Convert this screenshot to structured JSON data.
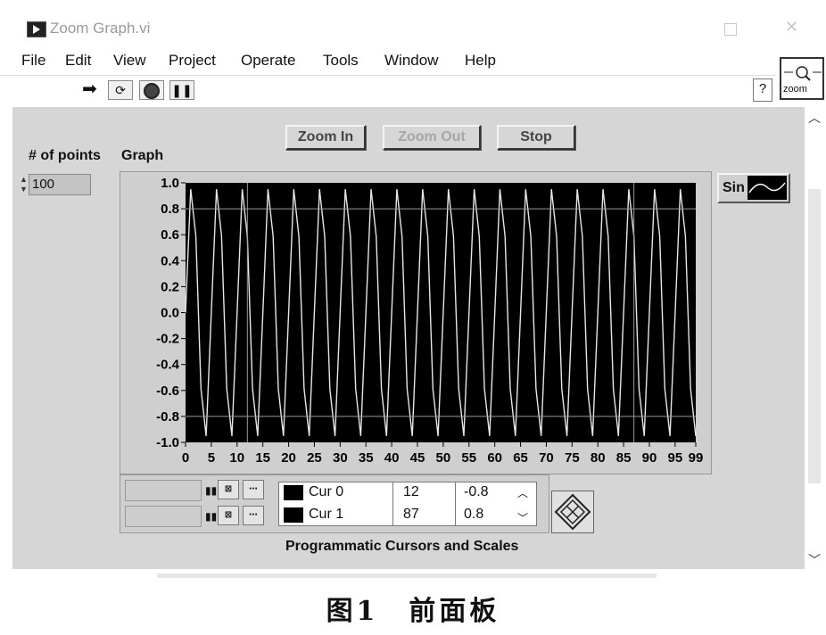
{
  "window": {
    "title": "Zoom Graph.vi"
  },
  "menu": [
    "File",
    "Edit",
    "View",
    "Project",
    "Operate",
    "Tools",
    "Window",
    "Help"
  ],
  "toolbar": {
    "help_glyph": "?",
    "vi_icon_label": "zoom"
  },
  "buttons": {
    "zoom_in": "Zoom In",
    "zoom_out": "Zoom Out",
    "stop": "Stop",
    "zoom_out_disabled": true
  },
  "points": {
    "label": "# of points",
    "value": "100"
  },
  "graph": {
    "label": "Graph",
    "legend_name": "Sin",
    "cursor_lines": {
      "cur0": [
        12,
        -0.8
      ],
      "cur1": [
        87,
        0.8
      ]
    }
  },
  "cursors": {
    "title": "Programmatic Cursors and Scales",
    "rows": [
      {
        "name": "Cur 0",
        "x": "12",
        "y": "-0.8"
      },
      {
        "name": "Cur 1",
        "x": "87",
        "y": "0.8"
      }
    ]
  },
  "caption": "图1　前面板",
  "chart_data": {
    "type": "line",
    "title": "",
    "xlabel": "",
    "ylabel": "",
    "xlim": [
      0,
      99
    ],
    "ylim": [
      -1.0,
      1.0
    ],
    "x_ticks": [
      "0",
      "5",
      "10",
      "15",
      "20",
      "25",
      "30",
      "35",
      "40",
      "45",
      "50",
      "55",
      "60",
      "65",
      "70",
      "75",
      "80",
      "85",
      "90",
      "95",
      "99"
    ],
    "y_ticks": [
      "1.0",
      "0.8",
      "0.6",
      "0.4",
      "0.2",
      "0.0",
      "-0.2",
      "-0.4",
      "-0.6",
      "-0.8",
      "-1.0"
    ],
    "grid": false,
    "background": "#000000",
    "series": [
      {
        "name": "Sin",
        "color": "#e6e6e6",
        "function": "sin",
        "points": 100,
        "cycles_per_sample": 0.2,
        "x": [
          0,
          1,
          2,
          3,
          4,
          5,
          6,
          7,
          8,
          9,
          10,
          11,
          12,
          13,
          14,
          15,
          16,
          17,
          18,
          19,
          20,
          21,
          22,
          23,
          24,
          25,
          26,
          27,
          28,
          29,
          30,
          31,
          32,
          33,
          34,
          35,
          36,
          37,
          38,
          39,
          40,
          41,
          42,
          43,
          44,
          45,
          46,
          47,
          48,
          49,
          50,
          51,
          52,
          53,
          54,
          55,
          56,
          57,
          58,
          59,
          60,
          61,
          62,
          63,
          64,
          65,
          66,
          67,
          68,
          69,
          70,
          71,
          72,
          73,
          74,
          75,
          76,
          77,
          78,
          79,
          80,
          81,
          82,
          83,
          84,
          85,
          86,
          87,
          88,
          89,
          90,
          91,
          92,
          93,
          94,
          95,
          96,
          97,
          98,
          99
        ]
      }
    ]
  }
}
